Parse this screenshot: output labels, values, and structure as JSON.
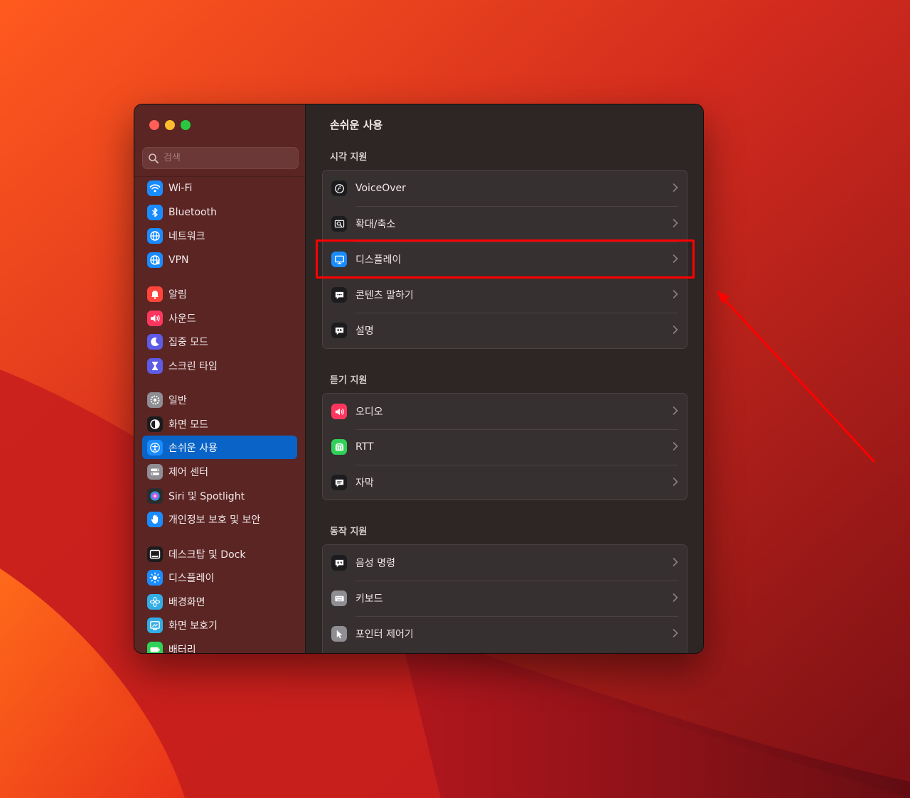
{
  "colors": {
    "accent": "#0a64c8",
    "annotation": "#ff0000"
  },
  "sidebar": {
    "search_placeholder": "검색",
    "items": [
      {
        "label": "Wi-Fi",
        "icon": "wifi-icon",
        "color": "#1a8cff"
      },
      {
        "label": "Bluetooth",
        "icon": "bluetooth-icon",
        "color": "#1a8cff"
      },
      {
        "label": "네트워크",
        "icon": "globe-icon",
        "color": "#1a8cff"
      },
      {
        "label": "VPN",
        "icon": "globe-vpn-icon",
        "color": "#1a8cff"
      },
      {
        "label": "알림",
        "icon": "bell-icon",
        "color": "#ff453a"
      },
      {
        "label": "사운드",
        "icon": "speaker-icon",
        "color": "#ff375f"
      },
      {
        "label": "집중 모드",
        "icon": "moon-icon",
        "color": "#5e5ce6"
      },
      {
        "label": "스크린 타임",
        "icon": "hourglass-icon",
        "color": "#5e5ce6"
      },
      {
        "label": "일반",
        "icon": "gear-icon",
        "color": "#8e8e93"
      },
      {
        "label": "화면 모드",
        "icon": "appearance-icon",
        "color": "#1c1c1e"
      },
      {
        "label": "손쉬운 사용",
        "icon": "accessibility-icon",
        "color": "#1a8cff",
        "selected": true
      },
      {
        "label": "제어 센터",
        "icon": "control-center-icon",
        "color": "#8e8e93"
      },
      {
        "label": "Siri 및 Spotlight",
        "icon": "siri-icon",
        "color": "#2c2c2e"
      },
      {
        "label": "개인정보 보호 및 보안",
        "icon": "hand-icon",
        "color": "#1a8cff"
      },
      {
        "label": "데스크탑 및 Dock",
        "icon": "dock-icon",
        "color": "#1c1c1e"
      },
      {
        "label": "디스플레이",
        "icon": "sun-icon",
        "color": "#1a8cff"
      },
      {
        "label": "배경화면",
        "icon": "flower-icon",
        "color": "#32ade6"
      },
      {
        "label": "화면 보호기",
        "icon": "screensaver-icon",
        "color": "#32ade6"
      },
      {
        "label": "배터리",
        "icon": "battery-icon",
        "color": "#30d158"
      }
    ]
  },
  "main": {
    "title": "손쉬운 사용",
    "sections": [
      {
        "title": "시각 지원",
        "rows": [
          {
            "label": "VoiceOver",
            "icon": "voiceover-icon",
            "color": "#1c1c1e"
          },
          {
            "label": "확대/축소",
            "icon": "zoom-icon",
            "color": "#1c1c1e"
          },
          {
            "label": "디스플레이",
            "icon": "display-icon",
            "color": "#1a8cff"
          },
          {
            "label": "콘텐츠 말하기",
            "icon": "speech-bubble-icon",
            "color": "#1c1c1e"
          },
          {
            "label": "설명",
            "icon": "description-bubble-icon",
            "color": "#1c1c1e"
          }
        ]
      },
      {
        "title": "듣기 지원",
        "rows": [
          {
            "label": "오디오",
            "icon": "audio-icon",
            "color": "#ff375f"
          },
          {
            "label": "RTT",
            "icon": "rtt-icon",
            "color": "#30d158"
          },
          {
            "label": "자막",
            "icon": "captions-icon",
            "color": "#1c1c1e"
          }
        ]
      },
      {
        "title": "동작 지원",
        "rows": [
          {
            "label": "음성 명령",
            "icon": "voice-control-icon",
            "color": "#1c1c1e"
          },
          {
            "label": "키보드",
            "icon": "keyboard-icon",
            "color": "#8e8e93"
          },
          {
            "label": "포인터 제어기",
            "icon": "pointer-icon",
            "color": "#8e8e93"
          }
        ]
      }
    ]
  }
}
